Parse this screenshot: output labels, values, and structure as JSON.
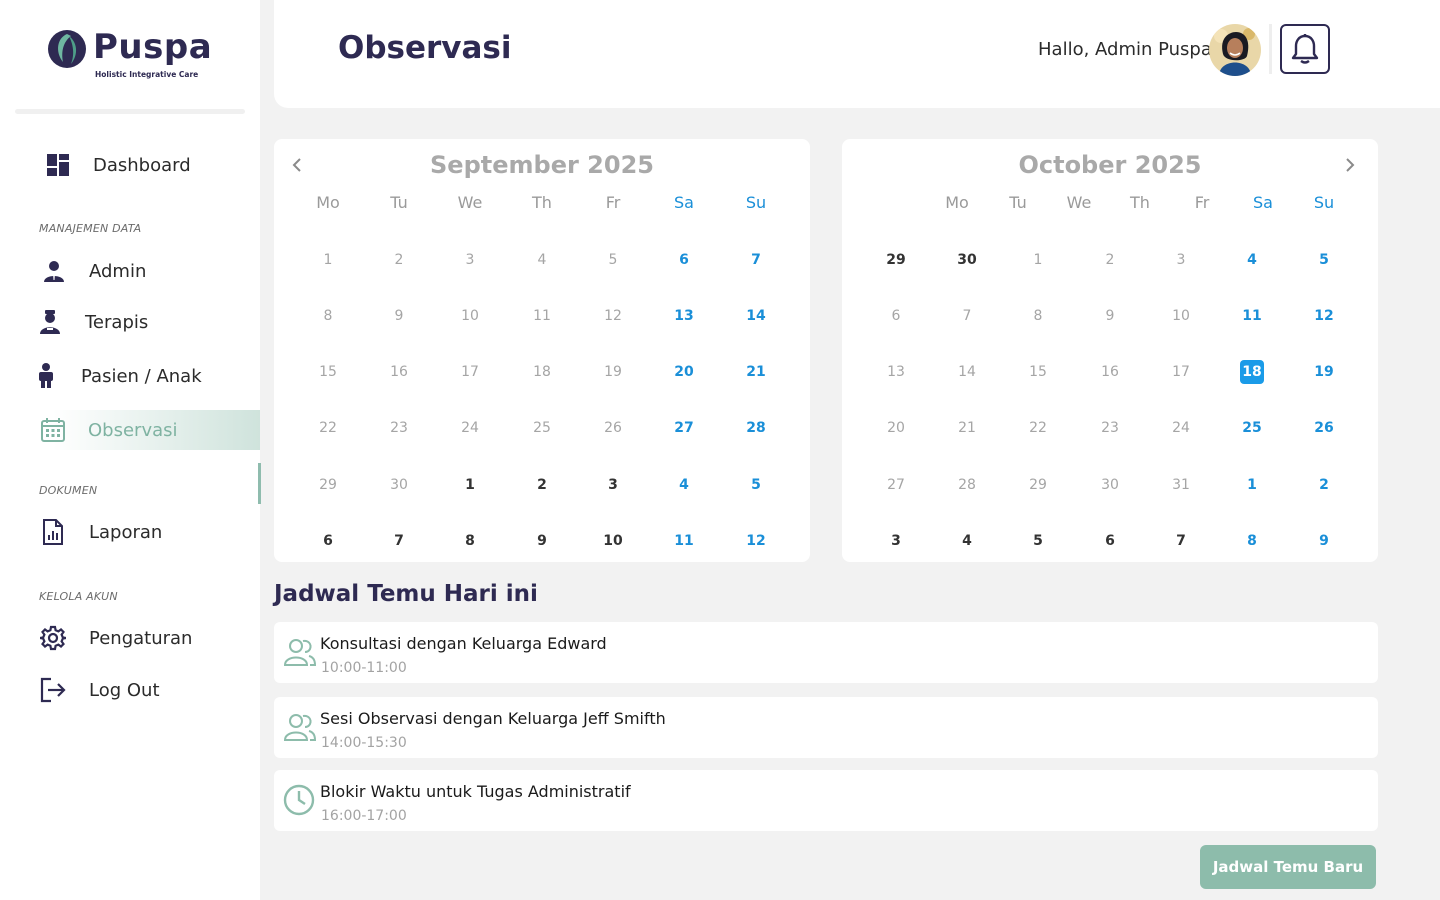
{
  "brand": {
    "name": "Puspa",
    "tagline": "Holistic Integrative Care"
  },
  "sidebar": {
    "items": [
      {
        "label": "Dashboard",
        "icon": "dashboard-icon"
      },
      {
        "label": "Admin",
        "icon": "admin-icon"
      },
      {
        "label": "Terapis",
        "icon": "therapist-icon"
      },
      {
        "label": "Pasien / Anak",
        "icon": "child-icon"
      },
      {
        "label": "Observasi",
        "icon": "calendar-icon",
        "active": true
      },
      {
        "label": "Laporan",
        "icon": "report-icon"
      },
      {
        "label": "Pengaturan",
        "icon": "gear-icon"
      },
      {
        "label": "Log Out",
        "icon": "logout-icon"
      }
    ],
    "sections": [
      "MANAJEMEN DATA",
      "DOKUMEN",
      "KELOLA AKUN"
    ]
  },
  "header": {
    "title": "Observasi",
    "greeting": "Hallo, Admin Puspa"
  },
  "calendars": [
    {
      "title": "September 2025",
      "weekdays": [
        "Mo",
        "Tu",
        "We",
        "Th",
        "Fr",
        "Sa",
        "Su"
      ],
      "weeks": [
        [
          "1",
          "2",
          "3",
          "4",
          "5",
          "6",
          "7"
        ],
        [
          "8",
          "9",
          "10",
          "11",
          "12",
          "13",
          "14"
        ],
        [
          "15",
          "16",
          "17",
          "18",
          "19",
          "20",
          "21"
        ],
        [
          "22",
          "23",
          "24",
          "25",
          "26",
          "27",
          "28"
        ],
        [
          "29",
          "30",
          "1",
          "2",
          "3",
          "4",
          "5"
        ],
        [
          "6",
          "7",
          "8",
          "9",
          "10",
          "11",
          "12"
        ]
      ]
    },
    {
      "title": "October 2025",
      "weekdays": [
        "Mo",
        "Tu",
        "We",
        "Th",
        "Fr",
        "Sa",
        "Su"
      ],
      "weeks": [
        [
          "29",
          "30",
          "1",
          "2",
          "3",
          "4",
          "5"
        ],
        [
          "6",
          "7",
          "8",
          "9",
          "10",
          "11",
          "12"
        ],
        [
          "13",
          "14",
          "15",
          "16",
          "17",
          "18",
          "19"
        ],
        [
          "20",
          "21",
          "22",
          "23",
          "24",
          "25",
          "26"
        ],
        [
          "27",
          "28",
          "29",
          "30",
          "31",
          "1",
          "2"
        ],
        [
          "3",
          "4",
          "5",
          "6",
          "7",
          "8",
          "9"
        ]
      ],
      "selected": "18"
    }
  ],
  "schedule": {
    "title": "Jadwal Temu Hari ini",
    "items": [
      {
        "title": "Konsultasi dengan Keluarga Edward",
        "time": "10:00-11:00",
        "icon": "people-icon"
      },
      {
        "title": "Sesi Observasi dengan Keluarga Jeff Smifth",
        "time": "14:00-15:30",
        "icon": "people-icon"
      },
      {
        "title": "Blokir Waktu untuk Tugas Administratif",
        "time": "16:00-17:00",
        "icon": "clock-icon"
      }
    ]
  },
  "new_button": "Jadwal Temu Baru",
  "colors": {
    "brand": "#2e2a52",
    "accent": "#8dbcab",
    "weekend": "#1a8fd8",
    "selected": "#1a9be8"
  }
}
